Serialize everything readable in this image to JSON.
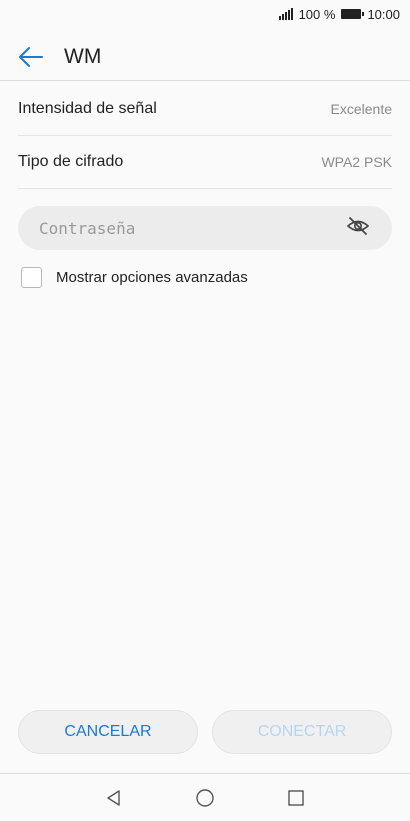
{
  "status_bar": {
    "signal_icon": "signal-icon",
    "battery_percent": "100 %",
    "battery_icon": "battery-icon",
    "time": "10:00"
  },
  "header": {
    "back_icon": "arrow-left-icon",
    "title": "WM"
  },
  "details": [
    {
      "label": "Intensidad de señal",
      "value": "Excelente"
    },
    {
      "label": "Tipo de cifrado",
      "value": "WPA2 PSK"
    }
  ],
  "password": {
    "placeholder": "Contraseña",
    "value": "",
    "toggle_icon": "eye-off-icon"
  },
  "advanced": {
    "label": "Mostrar opciones avanzadas",
    "checked": false
  },
  "buttons": {
    "cancel": "CANCELAR",
    "connect": "CONECTAR"
  },
  "nav": {
    "back": "triangle-back-icon",
    "home": "circle-home-icon",
    "recents": "square-recents-icon"
  },
  "colors": {
    "accent": "#1a7ad4",
    "disabled_accent": "#b8d5f0"
  }
}
